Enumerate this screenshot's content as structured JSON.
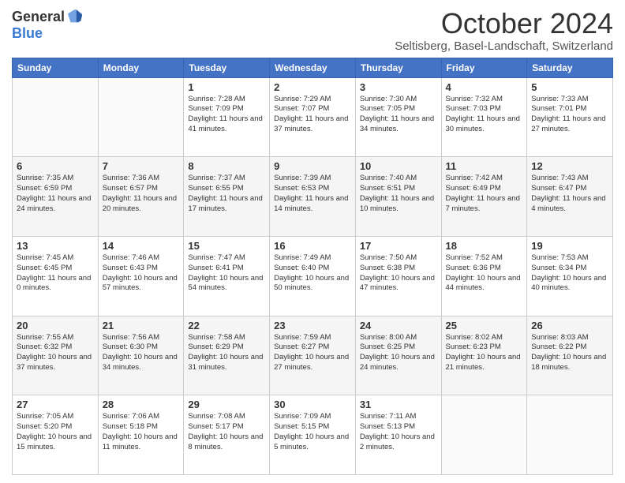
{
  "header": {
    "logo_general": "General",
    "logo_blue": "Blue",
    "month": "October 2024",
    "location": "Seltisberg, Basel-Landschaft, Switzerland"
  },
  "columns": [
    "Sunday",
    "Monday",
    "Tuesday",
    "Wednesday",
    "Thursday",
    "Friday",
    "Saturday"
  ],
  "weeks": [
    [
      {
        "day": "",
        "info": ""
      },
      {
        "day": "",
        "info": ""
      },
      {
        "day": "1",
        "info": "Sunrise: 7:28 AM\nSunset: 7:09 PM\nDaylight: 11 hours and 41 minutes."
      },
      {
        "day": "2",
        "info": "Sunrise: 7:29 AM\nSunset: 7:07 PM\nDaylight: 11 hours and 37 minutes."
      },
      {
        "day": "3",
        "info": "Sunrise: 7:30 AM\nSunset: 7:05 PM\nDaylight: 11 hours and 34 minutes."
      },
      {
        "day": "4",
        "info": "Sunrise: 7:32 AM\nSunset: 7:03 PM\nDaylight: 11 hours and 30 minutes."
      },
      {
        "day": "5",
        "info": "Sunrise: 7:33 AM\nSunset: 7:01 PM\nDaylight: 11 hours and 27 minutes."
      }
    ],
    [
      {
        "day": "6",
        "info": "Sunrise: 7:35 AM\nSunset: 6:59 PM\nDaylight: 11 hours and 24 minutes."
      },
      {
        "day": "7",
        "info": "Sunrise: 7:36 AM\nSunset: 6:57 PM\nDaylight: 11 hours and 20 minutes."
      },
      {
        "day": "8",
        "info": "Sunrise: 7:37 AM\nSunset: 6:55 PM\nDaylight: 11 hours and 17 minutes."
      },
      {
        "day": "9",
        "info": "Sunrise: 7:39 AM\nSunset: 6:53 PM\nDaylight: 11 hours and 14 minutes."
      },
      {
        "day": "10",
        "info": "Sunrise: 7:40 AM\nSunset: 6:51 PM\nDaylight: 11 hours and 10 minutes."
      },
      {
        "day": "11",
        "info": "Sunrise: 7:42 AM\nSunset: 6:49 PM\nDaylight: 11 hours and 7 minutes."
      },
      {
        "day": "12",
        "info": "Sunrise: 7:43 AM\nSunset: 6:47 PM\nDaylight: 11 hours and 4 minutes."
      }
    ],
    [
      {
        "day": "13",
        "info": "Sunrise: 7:45 AM\nSunset: 6:45 PM\nDaylight: 11 hours and 0 minutes."
      },
      {
        "day": "14",
        "info": "Sunrise: 7:46 AM\nSunset: 6:43 PM\nDaylight: 10 hours and 57 minutes."
      },
      {
        "day": "15",
        "info": "Sunrise: 7:47 AM\nSunset: 6:41 PM\nDaylight: 10 hours and 54 minutes."
      },
      {
        "day": "16",
        "info": "Sunrise: 7:49 AM\nSunset: 6:40 PM\nDaylight: 10 hours and 50 minutes."
      },
      {
        "day": "17",
        "info": "Sunrise: 7:50 AM\nSunset: 6:38 PM\nDaylight: 10 hours and 47 minutes."
      },
      {
        "day": "18",
        "info": "Sunrise: 7:52 AM\nSunset: 6:36 PM\nDaylight: 10 hours and 44 minutes."
      },
      {
        "day": "19",
        "info": "Sunrise: 7:53 AM\nSunset: 6:34 PM\nDaylight: 10 hours and 40 minutes."
      }
    ],
    [
      {
        "day": "20",
        "info": "Sunrise: 7:55 AM\nSunset: 6:32 PM\nDaylight: 10 hours and 37 minutes."
      },
      {
        "day": "21",
        "info": "Sunrise: 7:56 AM\nSunset: 6:30 PM\nDaylight: 10 hours and 34 minutes."
      },
      {
        "day": "22",
        "info": "Sunrise: 7:58 AM\nSunset: 6:29 PM\nDaylight: 10 hours and 31 minutes."
      },
      {
        "day": "23",
        "info": "Sunrise: 7:59 AM\nSunset: 6:27 PM\nDaylight: 10 hours and 27 minutes."
      },
      {
        "day": "24",
        "info": "Sunrise: 8:00 AM\nSunset: 6:25 PM\nDaylight: 10 hours and 24 minutes."
      },
      {
        "day": "25",
        "info": "Sunrise: 8:02 AM\nSunset: 6:23 PM\nDaylight: 10 hours and 21 minutes."
      },
      {
        "day": "26",
        "info": "Sunrise: 8:03 AM\nSunset: 6:22 PM\nDaylight: 10 hours and 18 minutes."
      }
    ],
    [
      {
        "day": "27",
        "info": "Sunrise: 7:05 AM\nSunset: 5:20 PM\nDaylight: 10 hours and 15 minutes."
      },
      {
        "day": "28",
        "info": "Sunrise: 7:06 AM\nSunset: 5:18 PM\nDaylight: 10 hours and 11 minutes."
      },
      {
        "day": "29",
        "info": "Sunrise: 7:08 AM\nSunset: 5:17 PM\nDaylight: 10 hours and 8 minutes."
      },
      {
        "day": "30",
        "info": "Sunrise: 7:09 AM\nSunset: 5:15 PM\nDaylight: 10 hours and 5 minutes."
      },
      {
        "day": "31",
        "info": "Sunrise: 7:11 AM\nSunset: 5:13 PM\nDaylight: 10 hours and 2 minutes."
      },
      {
        "day": "",
        "info": ""
      },
      {
        "day": "",
        "info": ""
      }
    ]
  ]
}
